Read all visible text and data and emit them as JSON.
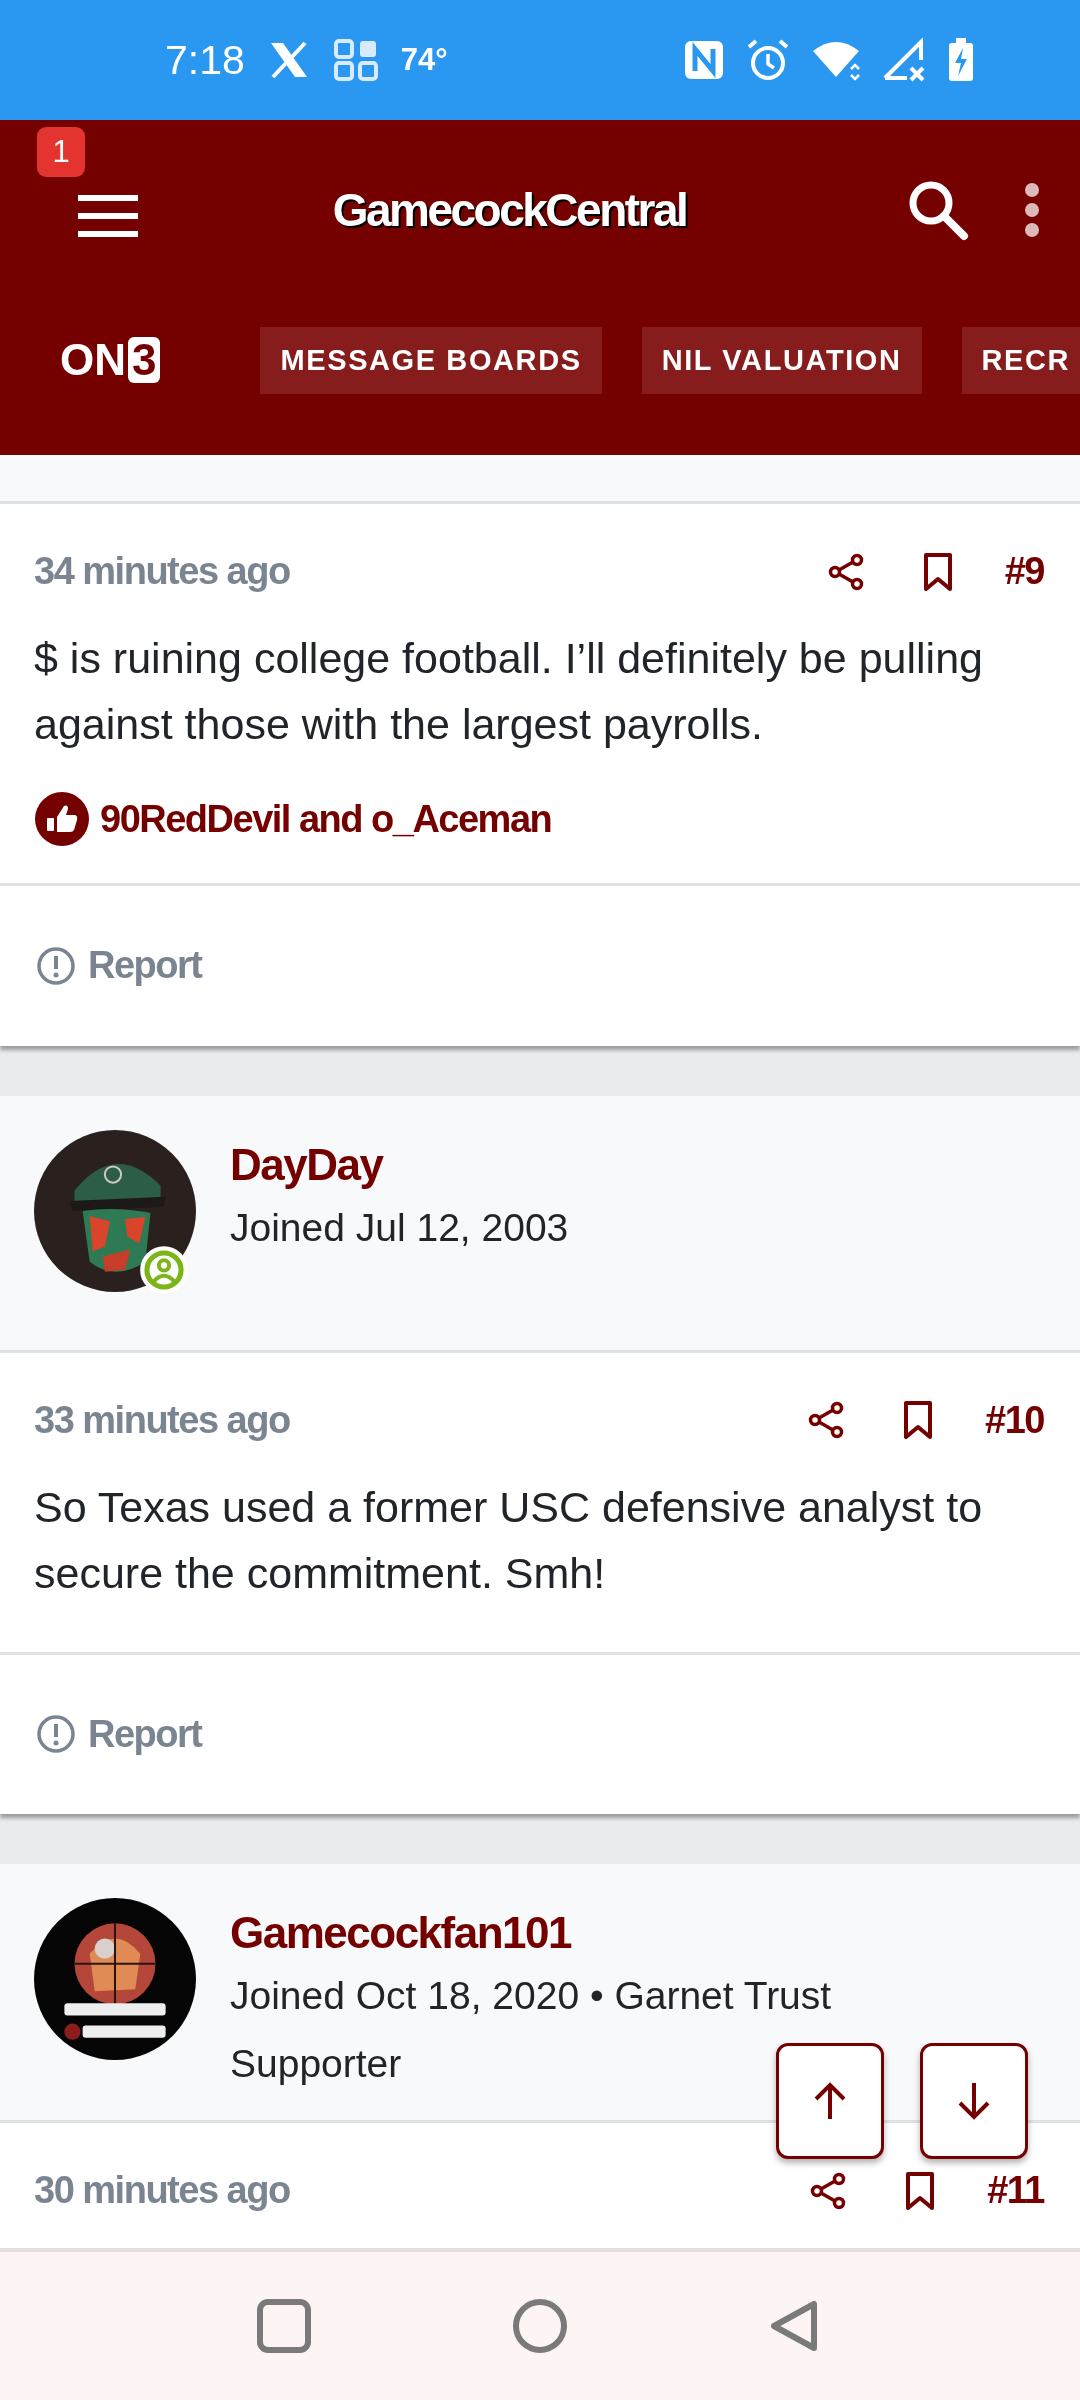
{
  "status_bar": {
    "time": "7:18",
    "temperature": "74°"
  },
  "header": {
    "notification_count": "1",
    "site_title": "GamecockCentral",
    "logo_text": "ON",
    "logo_mark": "3"
  },
  "nav": {
    "tabs": [
      {
        "label": "MESSAGE BOARDS",
        "selected": false
      },
      {
        "label": "NIL VALUATION",
        "selected": false
      },
      {
        "label": "RECR",
        "selected": false
      }
    ]
  },
  "posts": [
    {
      "time": "34 minutes ago",
      "number": "#9",
      "body": "$ is ruining college football. I’ll definitely be pulling against those with the largest payrolls.",
      "likes": "90RedDevil and o_Aceman",
      "report": "Report"
    },
    {
      "author": {
        "name": "DayDay",
        "joined": "Joined Jul 12, 2003",
        "online": true
      },
      "time": "33 minutes ago",
      "number": "#10",
      "body": "So Texas used a former USC defensive analyst to secure the commitment. Smh!",
      "report": "Report"
    },
    {
      "author": {
        "name": "Gamecockfan101",
        "joined": "Joined Oct 18, 2020 • Garnet Trust Supporter",
        "online": false
      },
      "time": "30 minutes ago",
      "number": "#11"
    }
  ]
}
